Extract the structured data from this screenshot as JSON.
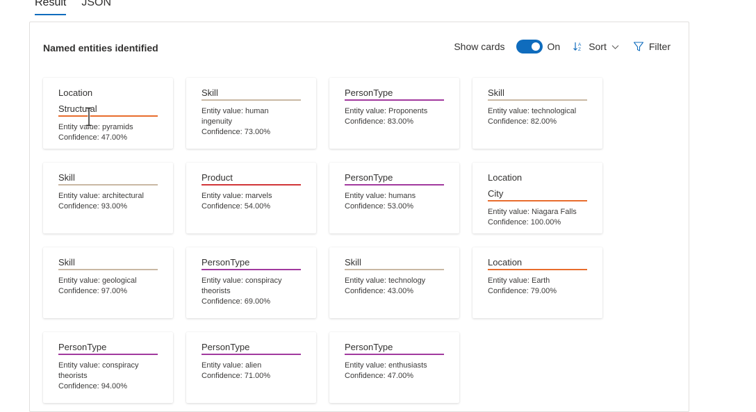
{
  "tabs": [
    {
      "label": "Result",
      "active": true
    },
    {
      "label": "JSON",
      "active": false
    }
  ],
  "panel": {
    "title": "Named entities identified",
    "show_cards_label": "Show cards",
    "toggle_state": "On",
    "toggle_on": true,
    "sort_label": "Sort",
    "filter_label": "Filter"
  },
  "colors": {
    "accent": "#0f6cbd",
    "Location": "#e86c2c",
    "Skill": "#c9b8a3",
    "PersonType": "#a1399e",
    "Product": "#d13438"
  },
  "cards": [
    {
      "category": "Location",
      "subcategory": "Structural",
      "value_text": "Entity value: pyramids",
      "confidence_text": "Confidence: 47.00%"
    },
    {
      "category": "Skill",
      "subcategory": "",
      "value_text": "Entity value: human ingenuity",
      "confidence_text": "Confidence: 73.00%"
    },
    {
      "category": "PersonType",
      "subcategory": "",
      "value_text": "Entity value: Proponents",
      "confidence_text": "Confidence: 83.00%"
    },
    {
      "category": "Skill",
      "subcategory": "",
      "value_text": "Entity value: technological",
      "confidence_text": "Confidence: 82.00%"
    },
    {
      "category": "Skill",
      "subcategory": "",
      "value_text": "Entity value: architectural",
      "confidence_text": "Confidence: 93.00%"
    },
    {
      "category": "Product",
      "subcategory": "",
      "value_text": "Entity value: marvels",
      "confidence_text": "Confidence: 54.00%"
    },
    {
      "category": "PersonType",
      "subcategory": "",
      "value_text": "Entity value: humans",
      "confidence_text": "Confidence: 53.00%"
    },
    {
      "category": "Location",
      "subcategory": "City",
      "value_text": "Entity value: Niagara Falls",
      "confidence_text": "Confidence: 100.00%"
    },
    {
      "category": "Skill",
      "subcategory": "",
      "value_text": "Entity value: geological",
      "confidence_text": "Confidence: 97.00%"
    },
    {
      "category": "PersonType",
      "subcategory": "",
      "value_text": "Entity value: conspiracy theorists",
      "confidence_text": "Confidence: 69.00%"
    },
    {
      "category": "Skill",
      "subcategory": "",
      "value_text": "Entity value: technology",
      "confidence_text": "Confidence: 43.00%"
    },
    {
      "category": "Location",
      "subcategory": "",
      "value_text": "Entity value: Earth",
      "confidence_text": "Confidence: 79.00%"
    },
    {
      "category": "PersonType",
      "subcategory": "",
      "value_text": "Entity value: conspiracy theorists",
      "confidence_text": "Confidence: 94.00%"
    },
    {
      "category": "PersonType",
      "subcategory": "",
      "value_text": "Entity value: alien",
      "confidence_text": "Confidence: 71.00%"
    },
    {
      "category": "PersonType",
      "subcategory": "",
      "value_text": "Entity value: enthusiasts",
      "confidence_text": "Confidence: 47.00%"
    }
  ]
}
